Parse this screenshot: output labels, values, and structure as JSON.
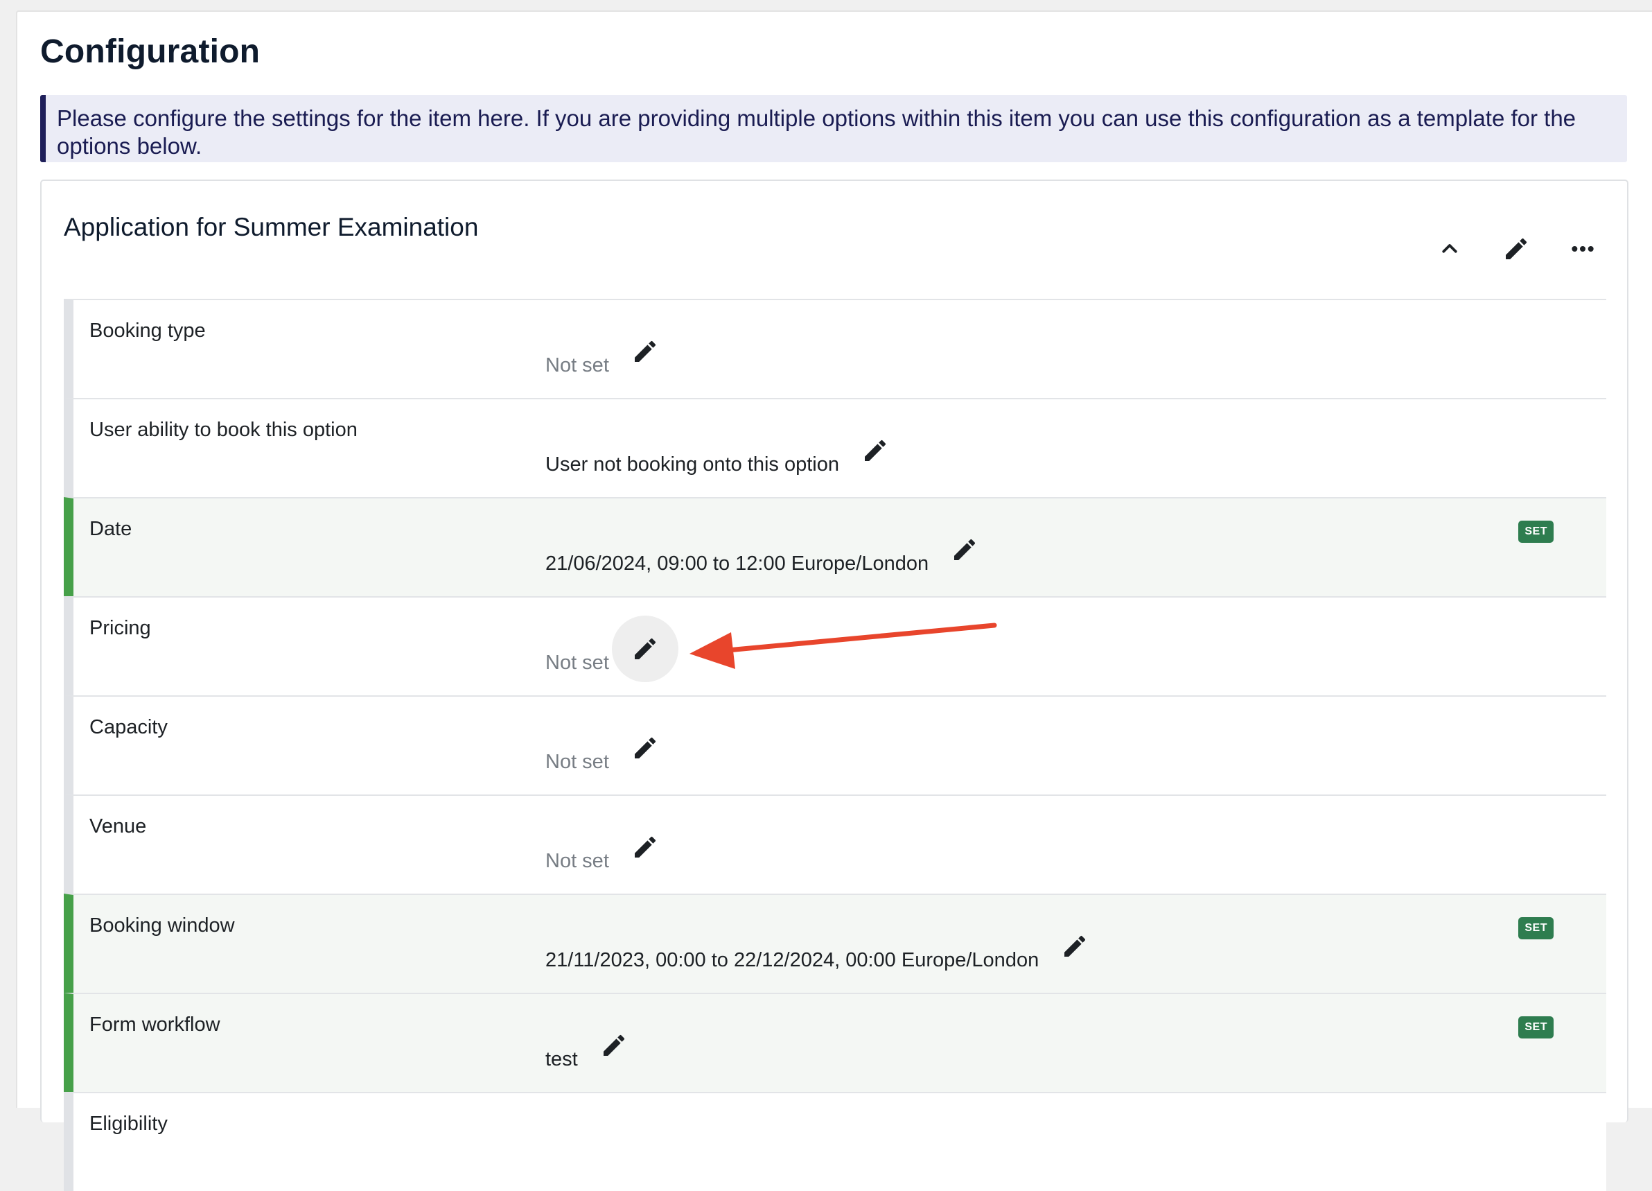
{
  "page": {
    "title": "Configuration",
    "notice": "Please configure the settings for the item here. If you are providing multiple options within this item you can use this configuration as a template for the options below."
  },
  "card": {
    "title": "Application for Summer Examination",
    "actions": [
      "chevron-up-icon",
      "pencil-icon",
      "more-horizontal-icon"
    ]
  },
  "rows": [
    {
      "label": "Booking type",
      "value": "Not set",
      "set": false
    },
    {
      "label": "User ability to book this option",
      "value": "User not booking onto this option",
      "set": false
    },
    {
      "label": "Date",
      "value": "21/06/2024, 09:00 to 12:00 Europe/London",
      "set": true,
      "badge": "SET"
    },
    {
      "label": "Pricing",
      "value": "Not set",
      "set": false,
      "highlighted": true
    },
    {
      "label": "Capacity",
      "value": "Not set",
      "set": false
    },
    {
      "label": "Venue",
      "value": "Not set",
      "set": false
    },
    {
      "label": "Booking window",
      "value": "21/11/2023, 00:00 to 22/12/2024, 00:00 Europe/London",
      "set": true,
      "badge": "SET"
    },
    {
      "label": "Form workflow",
      "value": "test",
      "set": true,
      "badge": "SET"
    },
    {
      "label": "Eligibility",
      "value": "",
      "set": false
    }
  ],
  "colors": {
    "accent_set": "#46a049",
    "badge": "#2e7d4f",
    "notice_bar": "#1f1f5a",
    "annotation_arrow": "#e8452c"
  }
}
